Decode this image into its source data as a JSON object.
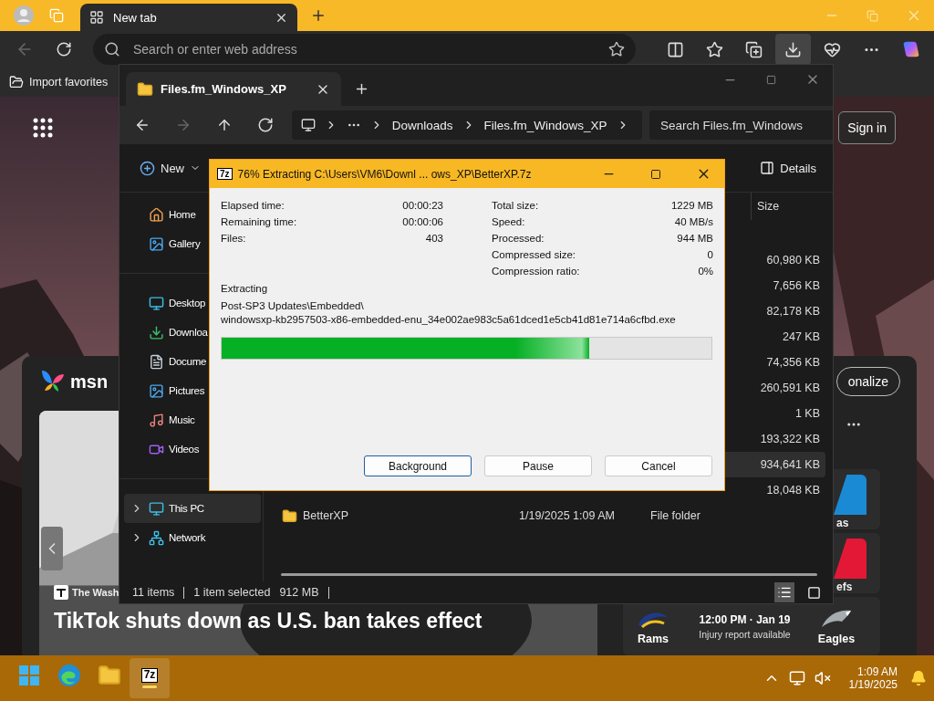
{
  "browser": {
    "tabs": [
      {
        "label": "New tab",
        "selected": true
      }
    ],
    "back_disabled": true,
    "address_bar": {
      "placeholder": "Search or enter web address"
    },
    "toolbar_buttons": [
      {
        "kind": "split",
        "selected": false
      },
      {
        "kind": "favorites",
        "selected": false
      },
      {
        "kind": "collections",
        "selected": false
      },
      {
        "kind": "downloads",
        "selected": true
      },
      {
        "kind": "health",
        "selected": false
      },
      {
        "kind": "more",
        "selected": false
      },
      {
        "kind": "copilot",
        "selected": false
      }
    ],
    "favorites_bar": [
      {
        "label": "Import favorites"
      }
    ],
    "page": {
      "sign_in": "Sign in",
      "msn": {
        "logo_text": "msn",
        "personalize": "onalize",
        "news": {
          "source": "The Wash",
          "headline": "TikTok shuts down as U.S. ban takes effect"
        },
        "game_tiles": [
          {
            "label": "as",
            "color": "#1a8ad4"
          },
          {
            "label": "efs",
            "color": "#e31837"
          }
        ],
        "game": {
          "home": "Rams",
          "away": "Eagles",
          "time": "12:00 PM · Jan 19",
          "note": "Injury report available"
        }
      }
    }
  },
  "explorer": {
    "tab": {
      "title": "Files.fm_Windows_XP"
    },
    "nav": [
      {
        "kind": "back",
        "disabled": false
      },
      {
        "kind": "forward",
        "disabled": true
      },
      {
        "kind": "up",
        "disabled": false
      },
      {
        "kind": "refresh",
        "disabled": false
      }
    ],
    "breadcrumbs": [
      "Downloads",
      "Files.fm_Windows_XP"
    ],
    "search": {
      "placeholder": "Search Files.fm_Windows"
    },
    "new_button": "New",
    "details_button": "Details",
    "sidebar": [
      {
        "items": [
          {
            "kind": "home",
            "label": "Home",
            "selected": false,
            "expandable": false
          },
          {
            "kind": "gallery",
            "label": "Gallery",
            "selected": false,
            "expandable": false
          }
        ]
      },
      {
        "items": [
          {
            "kind": "desktop",
            "label": "Desktop",
            "selected": false,
            "expandable": false
          },
          {
            "kind": "downloads",
            "label": "Downloa",
            "selected": false,
            "expandable": false
          },
          {
            "kind": "documents",
            "label": "Docume",
            "selected": false,
            "expandable": false
          },
          {
            "kind": "pictures",
            "label": "Pictures",
            "selected": false,
            "expandable": false
          },
          {
            "kind": "music",
            "label": "Music",
            "selected": false,
            "expandable": false
          },
          {
            "kind": "videos",
            "label": "Videos",
            "selected": false,
            "expandable": false
          }
        ]
      },
      {
        "items": [
          {
            "kind": "pc",
            "label": "This PC",
            "selected": true,
            "expandable": true
          },
          {
            "kind": "network",
            "label": "Network",
            "selected": false,
            "expandable": true
          }
        ]
      }
    ],
    "size_column": "Size",
    "files": [
      {
        "size": "60,980 KB",
        "selected": false
      },
      {
        "size": "7,656 KB",
        "selected": false
      },
      {
        "size": "82,178 KB",
        "selected": false
      },
      {
        "size": "247 KB",
        "selected": false
      },
      {
        "size": "74,356 KB",
        "selected": false
      },
      {
        "size": "260,591 KB",
        "selected": false
      },
      {
        "size": "1 KB",
        "selected": false
      },
      {
        "size": "193,322 KB",
        "selected": false
      },
      {
        "size": "934,641 KB",
        "selected": true
      },
      {
        "size": "18,048 KB",
        "selected": false
      },
      {
        "name": "BetterXP",
        "date": "1/19/2025 1:09 AM",
        "type": "File folder",
        "selected": false
      }
    ],
    "status": {
      "count": "11 items",
      "selection": "1 item selected",
      "selection_size": "912 MB"
    },
    "views": [
      {
        "kind": "details",
        "selected": true
      },
      {
        "kind": "tiles",
        "selected": false
      }
    ]
  },
  "dialog": {
    "icon_text": "7z",
    "title": "76% Extracting C:\\Users\\VM6\\Downl ... ows_XP\\BetterXP.7z",
    "left_stats": [
      {
        "label": "Elapsed time:",
        "value": "00:00:23"
      },
      {
        "label": "Remaining time:",
        "value": "00:00:06"
      },
      {
        "label": "Files:",
        "value": "403"
      }
    ],
    "right_stats": [
      {
        "label": "Total size:",
        "value": "1229 MB"
      },
      {
        "label": "Speed:",
        "value": "40 MB/s"
      },
      {
        "label": "Processed:",
        "value": "944 MB"
      },
      {
        "label": "Compressed size:",
        "value": "0"
      },
      {
        "label": "Compression ratio:",
        "value": "0%"
      }
    ],
    "status": "Extracting",
    "path": [
      "Post-SP3 Updates\\Embedded\\",
      "windowsxp-kb2957503-x86-embedded-enu_34e002ae983c5a61dced1e5cb41d81e714a6cfbd.exe"
    ],
    "progress": {
      "level": 0.75
    },
    "buttons": [
      {
        "label": "Background",
        "focused": true
      },
      {
        "label": "Pause",
        "focused": false
      },
      {
        "label": "Cancel",
        "focused": false
      }
    ]
  },
  "taskbar": {
    "apps": [
      {
        "kind": "start",
        "active": false
      },
      {
        "kind": "edge",
        "active": false
      },
      {
        "kind": "explorer",
        "active": false
      },
      {
        "kind": "archiver",
        "active": true,
        "icon_text": "7z"
      }
    ],
    "time": "1:09 AM",
    "date": "1/19/2025"
  }
}
